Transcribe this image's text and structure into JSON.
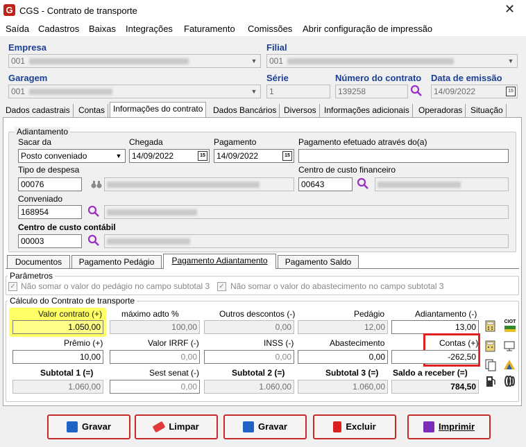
{
  "window": {
    "title": "CGS - Contrato de transporte",
    "close": "✕"
  },
  "menu": [
    "Saída",
    "Cadastros",
    "Baixas",
    "Integrações",
    "Faturamento",
    "Comissões",
    "Abrir configuração de impressão"
  ],
  "header": {
    "empresa_label": "Empresa",
    "empresa_value": "001",
    "filial_label": "Filial",
    "filial_value": "001",
    "garagem_label": "Garagem",
    "garagem_value": "001",
    "serie_label": "Série",
    "serie_value": "1",
    "numero_label": "Número do contrato",
    "numero_value": "139258",
    "data_label": "Data de emissão",
    "data_value": "14/09/2022"
  },
  "tabs": [
    "Dados cadastrais",
    "Contas",
    "Informações do contrato",
    "Dados Bancários",
    "Diversos",
    "Informações adicionais",
    "Operadoras",
    "Situação"
  ],
  "adiantamento": {
    "group_title": "Adiantamento",
    "sacar_label": "Sacar da",
    "sacar_value": "Posto conveniado",
    "chegada_label": "Chegada",
    "chegada_value": "14/09/2022",
    "pagamento_label": "Pagamento",
    "pagamento_value": "14/09/2022",
    "efetuado_label": "Pagamento efetuado através do(a)",
    "efetuado_value": "",
    "tipo_label": "Tipo de despesa",
    "tipo_value": "00076",
    "centro_fin_label": "Centro de custo financeiro",
    "centro_fin_value": "00643",
    "conveniado_label": "Conveniado",
    "conveniado_value": "168954",
    "centro_cont_label": "Centro de custo contábil",
    "centro_cont_value": "00003"
  },
  "subtabs": [
    "Documentos",
    "Pagamento Pedágio",
    "Pagamento Adiantamento",
    "Pagamento Saldo"
  ],
  "parametros": {
    "title": "Parâmetros",
    "check1": "Não somar o valor do pedágio no campo subtotal 3",
    "check2": "Não somar o valor do abastecimento no campo subtotal 3"
  },
  "calculo": {
    "title": "Cálculo do Contrato de transporte",
    "valor_contrato_label": "Valor contrato (+)",
    "valor_contrato": "1.050,00",
    "maximo_label": "máximo adto %",
    "maximo": "100,00",
    "outros_label": "Outros descontos (-)",
    "outros": "0,00",
    "pedagio_label": "Pedágio",
    "pedagio": "12,00",
    "adiantamento_label": "Adiantamento (-)",
    "adiantamento": "13,00",
    "premio_label": "Prêmio (+)",
    "premio": "10,00",
    "irrf_label": "Valor IRRF (-)",
    "irrf": "0,00",
    "inss_label": "INSS (-)",
    "inss": "0,00",
    "abastecimento_label": "Abastecimento",
    "abastecimento": "0,00",
    "contas_label": "Contas (+)",
    "contas": "-262,50",
    "sub1_label": "Subtotal 1 (=)",
    "sub1": "1.060,00",
    "sest_label": "Sest senat (-)",
    "sest": "0,00",
    "sub2_label": "Subtotal 2 (=)",
    "sub2": "1.060,00",
    "sub3_label": "Subtotal 3 (=)",
    "sub3": "1.060,00",
    "saldo_label": "Saldo a receber (=)",
    "saldo": "784,50",
    "ciot_label": "CIOT"
  },
  "buttons": {
    "gravar1": "Gravar",
    "limpar": "Limpar",
    "gravar2": "Gravar",
    "excluir": "Excluir",
    "imprimir": "Imprimir"
  },
  "colors": {
    "highlight_yellow": "#ffff66",
    "highlight_red": "#e02020",
    "label_blue": "#1c3f94",
    "brand_red": "#c0211a"
  }
}
